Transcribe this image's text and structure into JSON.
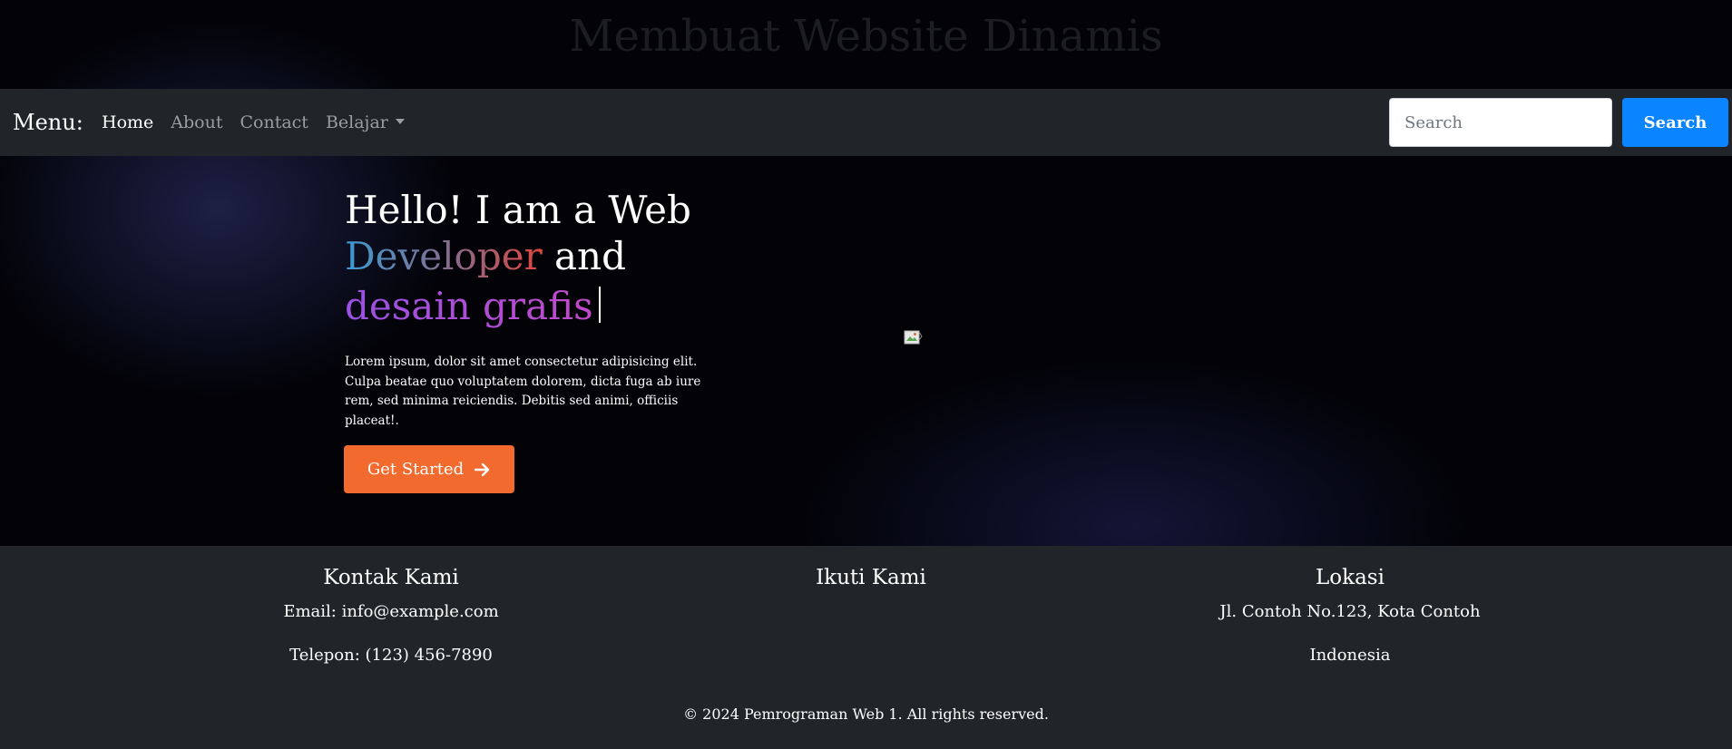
{
  "site": {
    "title": "Membuat Website Dinamis"
  },
  "navbar": {
    "brand": "Menu:",
    "links": [
      {
        "label": "Home"
      },
      {
        "label": "About"
      },
      {
        "label": "Contact"
      },
      {
        "label": "Belajar"
      }
    ],
    "search_placeholder": "Search",
    "search_button": "Search"
  },
  "hero": {
    "heading_line1": "Hello! I am a Web",
    "heading_gradient_word": "Developer",
    "heading_and": "and",
    "heading_typed": "desain grafis",
    "description": "Lorem ipsum, dolor sit amet consectetur adipisicing elit. Culpa beatae quo voluptatem dolorem, dicta fuga ab iure rem, sed minima reiciendis. Debitis sed animi, officiis placeat!.",
    "cta_label": "Get Started"
  },
  "footer": {
    "contact": {
      "heading": "Kontak Kami",
      "email": "Email: info@example.com",
      "phone": "Telepon: (123) 456-7890"
    },
    "follow": {
      "heading": "Ikuti Kami"
    },
    "location": {
      "heading": "Lokasi",
      "address": "Jl. Contoh No.123, Kota Contoh",
      "country": "Indonesia"
    },
    "copyright": "© 2024 Pemrograman Web 1. All rights reserved."
  },
  "colors": {
    "navbar_bg": "#212529",
    "search_button": "#0b84ff",
    "cta_button": "#f26a2e",
    "developer_gradient": [
      "#3a9bd1",
      "#e0453f"
    ],
    "grafis_gradient": [
      "#9a52e3",
      "#c04ac9"
    ]
  },
  "icons": {
    "cta_icon": "arrow-right-icon",
    "dropdown_icon": "caret-down-icon",
    "image": "broken-image-icon"
  }
}
